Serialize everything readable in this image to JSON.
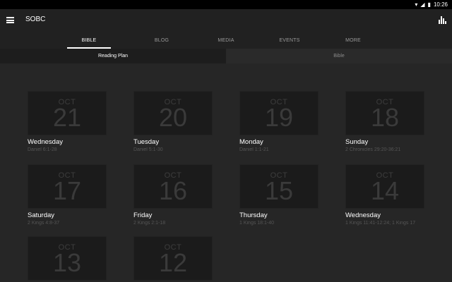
{
  "status": {
    "time": "10:26",
    "wifi_icon": "wifi-icon",
    "signal_icon": "signal-icon",
    "battery_icon": "battery-icon"
  },
  "appbar": {
    "title": "SOBC"
  },
  "tabs": [
    {
      "label": "BIBLE",
      "active": true
    },
    {
      "label": "BLOG",
      "active": false
    },
    {
      "label": "MEDIA",
      "active": false
    },
    {
      "label": "EVENTS",
      "active": false
    },
    {
      "label": "MORE",
      "active": false
    }
  ],
  "subtabs": [
    {
      "label": "Reading Plan",
      "active": true
    },
    {
      "label": "Bible",
      "active": false
    }
  ],
  "cards": [
    {
      "month": "OCT",
      "day": "21",
      "weekday": "Wednesday",
      "passage": "Daniel 6:1-28"
    },
    {
      "month": "OCT",
      "day": "20",
      "weekday": "Tuesday",
      "passage": "Daniel 5:1-30"
    },
    {
      "month": "OCT",
      "day": "19",
      "weekday": "Monday",
      "passage": "Daniel 1:1-21"
    },
    {
      "month": "OCT",
      "day": "18",
      "weekday": "Sunday",
      "passage": "2 Chronicles 29:20-36:21"
    },
    {
      "month": "OCT",
      "day": "17",
      "weekday": "Saturday",
      "passage": "2 Kings 4:8-37"
    },
    {
      "month": "OCT",
      "day": "16",
      "weekday": "Friday",
      "passage": "2 Kings 2:1-18"
    },
    {
      "month": "OCT",
      "day": "15",
      "weekday": "Thursday",
      "passage": "1 Kings 18:1-40"
    },
    {
      "month": "OCT",
      "day": "14",
      "weekday": "Wednesday",
      "passage": "1 Kings 11:41-12:24; 1 Kings 17"
    },
    {
      "month": "OCT",
      "day": "13",
      "weekday": "",
      "passage": ""
    },
    {
      "month": "OCT",
      "day": "12",
      "weekday": "",
      "passage": ""
    }
  ]
}
